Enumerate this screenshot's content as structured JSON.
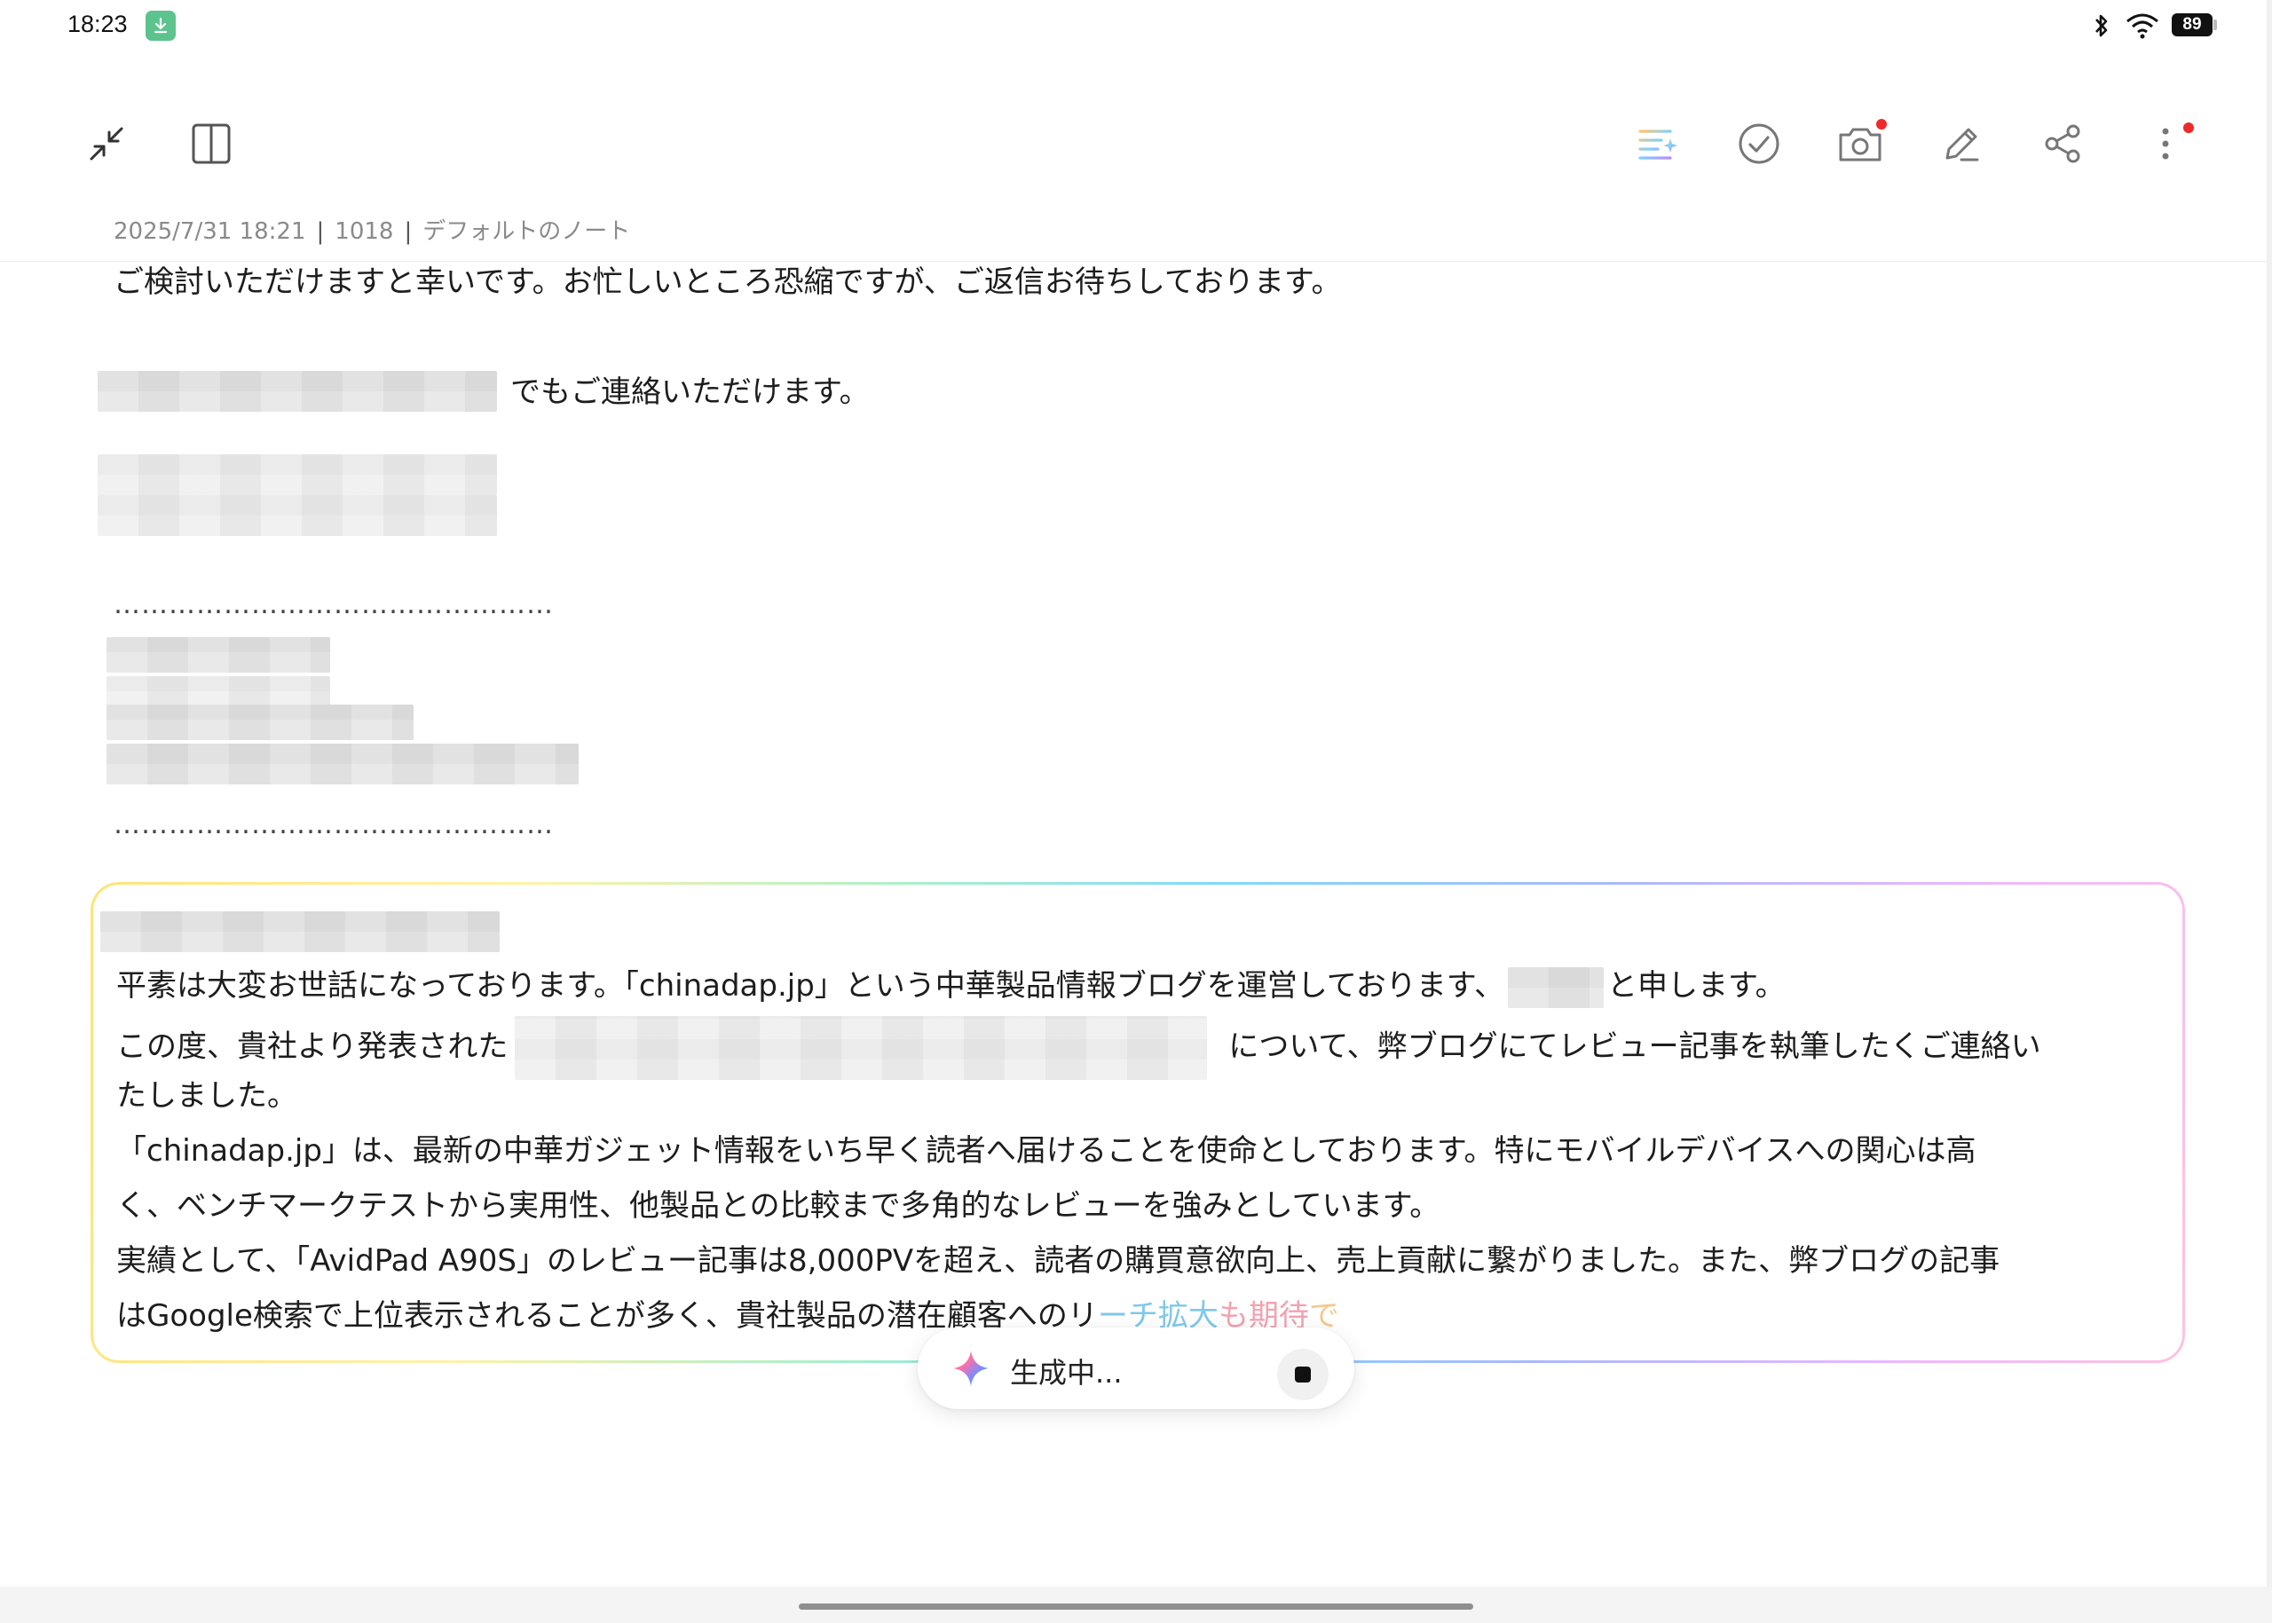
{
  "status_bar": {
    "time": "18:23",
    "battery": "89",
    "icons": [
      "download-icon",
      "bluetooth-icon",
      "wifi-icon",
      "battery-icon"
    ]
  },
  "toolbar": {
    "left_icons": [
      "collapse-icon",
      "split-view-icon"
    ],
    "right_icons": [
      "ai-format-icon",
      "checklist-icon",
      "camera-icon",
      "pen-icon",
      "share-icon",
      "more-icon"
    ],
    "notification_dot_color": "#ee2a2a"
  },
  "meta": {
    "datetime": "2025/7/31 18:21",
    "sep": "|",
    "char_count": "1018",
    "notebook": "デフォルトのノート"
  },
  "note": {
    "line1": "ご検討いただけますと幸いです。お忙しいところ恐縮ですが、ご返信お待ちしております。",
    "line2_suffix": "でもご連絡いただけます。",
    "dots": "…………………………………………",
    "dots_bottom": "…………………………………………"
  },
  "ai_box": {
    "p1a": "平素は大変お世話になっております。「chinadap.jp」という中華製品情報ブログを運営しております、",
    "p1b": "と申します。",
    "p2a": "この度、貴社より発表された",
    "p2b": "について、弊ブログにてレビュー記事を執筆したくご連絡い",
    "p2c": "たしました。",
    "p3a": "「chinadap.jp」は、最新の中華ガジェット情報をいち早く読者へ届けることを使命としております。特にモバイルデバイスへの関心は高",
    "p3b": "く、ベンチマークテストから実用性、他製品との比較まで多角的なレビューを強みとしています。",
    "p4a": "実績として、「AvidPad A90S」のレビュー記事は8,000PVを超え、読者の購買意欲向上、売上貢献に繋がりました。また、弊ブログの記事",
    "p4b_solid": "はGoogle検索で上位表示されることが多く、貴社製品の潜在顧客へのリ",
    "p4b_fade1": "ーチ拡大",
    "p4b_fade2": "も期待",
    "p4b_fade3": "で",
    "border_colors": [
      "#ffe27a",
      "#a8f0c8",
      "#7fd8ff",
      "#a8b8ff",
      "#f0b8ff",
      "#ffc2e0"
    ]
  },
  "generating": {
    "label": "生成中...",
    "icons": [
      "sparkle-icon",
      "stop-icon"
    ]
  }
}
